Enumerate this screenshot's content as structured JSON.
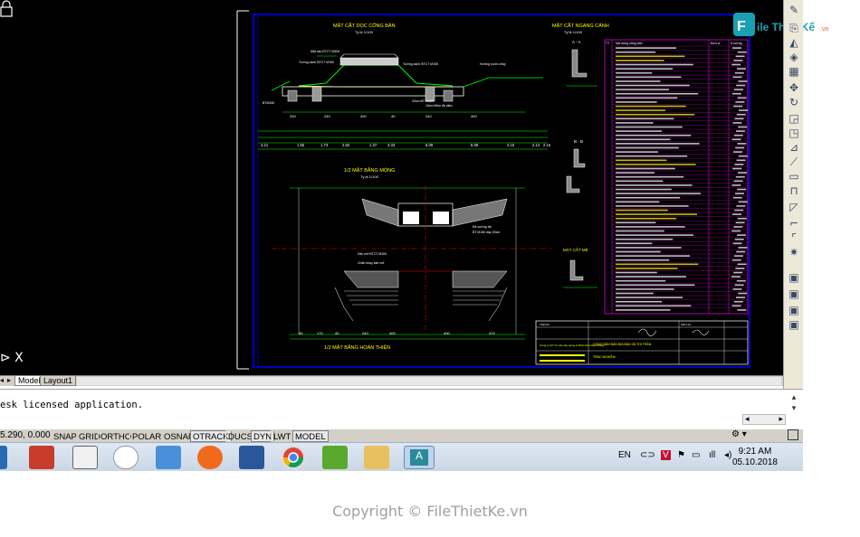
{
  "drawing": {
    "titles": {
      "section_long": "MẶT CẮT DỌC CỐNG BẢN",
      "section_long_scale": "Tỷ lệ 1/100",
      "half_foundation": "1/2 MẶT BẰNG MÓNG",
      "half_foundation_scale": "Tỷ lệ 1/100",
      "half_complete": "1/2 MẶT BẰNG HOÀN THIỆN",
      "cross_section": "MẶT CẮT NGANG CẢNH",
      "cross_section_scale": "Tỷ lệ 1/100",
      "sec_aa": "A - A",
      "sec_bb": "B - B",
      "sec_detail": "MẶT CẮT MÉ"
    },
    "road_label": "Hướng nước chảy",
    "dim_values": [
      "4.21",
      "1.55",
      "1.73",
      "2.82",
      "1.37",
      "3.33",
      "6.09",
      "6.09",
      "2.15",
      "2.13",
      "2.15"
    ],
    "table_header": [
      "TT",
      "Nội dung công việc",
      "Đơn vị",
      "K.lượng"
    ],
    "title_block": {
      "company": "Công ty CP Tư vấn xây dựng & Phát triển Giao thông",
      "project": "CỐNG BẢN BẢN ĐỊA BẢN XÃ THỊ TRẤN",
      "sheet": "TRẮC NGHIỆM",
      "designer": "Thiết kế",
      "checker": "Kiểm tra"
    }
  },
  "tabs": {
    "model": "Model",
    "layout1": "Layout1"
  },
  "command_line": {
    "text": "esk licensed application."
  },
  "status_bar": {
    "coords": "5.290, 0.000",
    "buttons": [
      "SNAP",
      "GRID",
      "ORTHO",
      "POLAR",
      "OSNAP",
      "OTRACK",
      "DUCS",
      "DYN",
      "LWT",
      "MODEL"
    ],
    "active": [
      "OTRACK",
      "DYN",
      "MODEL"
    ]
  },
  "taskbar": {
    "language": "EN",
    "time": "9:21 AM",
    "date": "05.10.2018",
    "apps": [
      "ctv-2013",
      "uin-tool",
      "recorder",
      "file-explorer",
      "firefox",
      "word",
      "chrome",
      "coccoc",
      "paint",
      "autocad"
    ]
  },
  "watermark": "Copyright © FileThietKe.vn",
  "brand": {
    "name": "File Thiết Kế",
    "domain": ".vn"
  },
  "colors": {
    "canvas": "#000000",
    "frame": "#0000ff",
    "cad_yellow": "#ffff00",
    "cad_green": "#00ff00",
    "cad_red": "#ff0000",
    "cad_white": "#ffffff",
    "brand_teal": "#1aa0b4"
  }
}
